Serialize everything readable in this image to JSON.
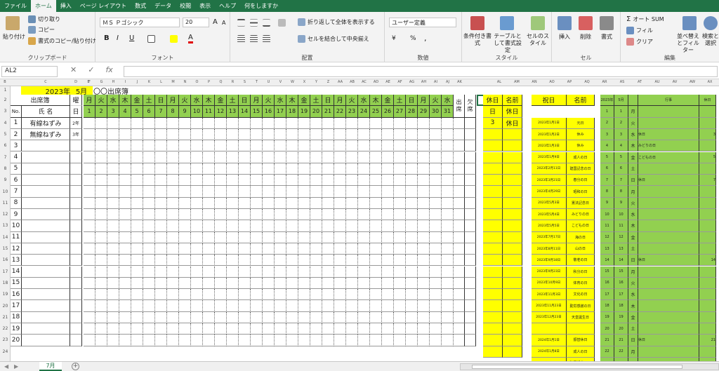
{
  "menu": {
    "tabs": [
      "ファイル",
      "ホーム",
      "挿入",
      "ページ レイアウト",
      "数式",
      "データ",
      "校閲",
      "表示",
      "ヘルプ",
      "何をしますか"
    ],
    "active": 1
  },
  "ribbon": {
    "clipboard": {
      "paste": "貼り付け",
      "cut": "切り取り",
      "copy": "コピー",
      "format_painter": "書式のコピー/貼り付け",
      "label": "クリップボード"
    },
    "font": {
      "name": "ＭＳ Ｐゴシック",
      "size": "20",
      "grow": "A",
      "shrink": "A",
      "bold": "B",
      "italic": "I",
      "underline": "U",
      "label": "フォント"
    },
    "alignment": {
      "wrap": "折り返して全体を表示する",
      "merge": "セルを結合して中央揃え",
      "label": "配置"
    },
    "number": {
      "format": "ユーザー定義",
      "currency": "¥",
      "percent": "%",
      "comma": ",",
      "label": "数値"
    },
    "styles": {
      "conditional": "条件付き書式",
      "table": "テーブルとして書式設定",
      "cell_style": "セルのスタイル",
      "label": "スタイル"
    },
    "cells": {
      "insert": "挿入",
      "delete": "削除",
      "format": "書式",
      "label": "セル"
    },
    "editing": {
      "autosum": "オート SUM",
      "fill": "フィル",
      "clear": "クリア",
      "sort": "並べ替えとフィルター",
      "find": "検索と選択",
      "label": "編集"
    }
  },
  "formula_bar": {
    "name_box": "AL2",
    "value": "",
    "cancel": "✕",
    "enter": "✓",
    "fx": "fx"
  },
  "columns": [
    "B",
    "C",
    "D",
    "E",
    "F",
    "G",
    "H",
    "I",
    "J",
    "K",
    "L",
    "M",
    "N",
    "O",
    "P",
    "Q",
    "R",
    "S",
    "T",
    "U",
    "V",
    "W",
    "X",
    "Y",
    "Z",
    "AA",
    "AB",
    "AC",
    "AD",
    "AE",
    "AF",
    "AG",
    "AH",
    "AI",
    "AJ",
    "AK",
    "AL",
    "AM",
    "AN",
    "AO",
    "AP",
    "AQ",
    "AR",
    "AS",
    "AT",
    "AU",
    "AV",
    "AW",
    "AX"
  ],
  "rows": [
    "1",
    "2",
    "3",
    "4",
    "5",
    "6",
    "7",
    "8",
    "9",
    "10",
    "11",
    "12",
    "13",
    "14",
    "15",
    "16",
    "17",
    "18",
    "19",
    "20",
    "21",
    "22",
    "23",
    "24"
  ],
  "sheet": {
    "year": "2023年",
    "month": "5月",
    "title": "〇〇出席簿",
    "header_title": "出席簿",
    "header_name": "氏 名",
    "header_no": "No.",
    "header_you": "曜",
    "header_bi": "日",
    "weekdays": [
      "月",
      "火",
      "水",
      "木",
      "金",
      "土",
      "日",
      "月",
      "火",
      "水",
      "木",
      "金",
      "土",
      "日",
      "月",
      "火",
      "水",
      "木",
      "金",
      "土",
      "日",
      "月",
      "火",
      "水",
      "木",
      "金",
      "土",
      "日",
      "月",
      "火",
      "水"
    ],
    "days": [
      "1",
      "2",
      "3",
      "4",
      "5",
      "6",
      "7",
      "8",
      "9",
      "10",
      "11",
      "12",
      "13",
      "14",
      "15",
      "16",
      "17",
      "18",
      "19",
      "20",
      "21",
      "22",
      "23",
      "24",
      "25",
      "26",
      "27",
      "28",
      "29",
      "30",
      "31"
    ],
    "attend": "出席",
    "absent": "欠席",
    "row_numbers": [
      "1",
      "2",
      "3",
      "4",
      "5",
      "6",
      "7",
      "8",
      "9",
      "10",
      "11",
      "12",
      "13",
      "14",
      "15",
      "16",
      "17",
      "18",
      "19",
      "20"
    ],
    "students": [
      {
        "name": "有線ねずみ",
        "grade": "2年"
      },
      {
        "name": "無線ねずみ",
        "grade": "3年"
      }
    ]
  },
  "holiday_panel": {
    "header_date": "休日",
    "header_name": "名前",
    "entries": [
      [
        "日",
        "休日"
      ],
      [
        "3",
        "休日"
      ]
    ]
  },
  "holiday_list": {
    "header_date": "祝日",
    "header_name": "名前",
    "entries": [
      [
        "2023年1月1日",
        "元日"
      ],
      [
        "2023年1月2日",
        "休み"
      ],
      [
        "2023年1月3日",
        "休み"
      ],
      [
        "2023年1月9日",
        "成人の日"
      ],
      [
        "2023年2月11日",
        "建国記念の日"
      ],
      [
        "2023年3月21日",
        "春分の日"
      ],
      [
        "2023年4月29日",
        "昭和の日"
      ],
      [
        "2023年5月3日",
        "憲法記念日"
      ],
      [
        "2023年5月4日",
        "みどりの日"
      ],
      [
        "2023年5月5日",
        "こどもの日"
      ],
      [
        "2023年7月17日",
        "海の日"
      ],
      [
        "2023年8月11日",
        "山の日"
      ],
      [
        "2023年9月18日",
        "敬老の日"
      ],
      [
        "2023年9月23日",
        "秋分の日"
      ],
      [
        "2023年10月9日",
        "体育の日"
      ],
      [
        "2023年11月3日",
        "文化の日"
      ],
      [
        "2023年11月23日",
        "勤労感謝の日"
      ],
      [
        "2023年12月23日",
        "天皇誕生日"
      ],
      [
        "",
        ""
      ],
      [
        "2024年1月1日",
        "振替休日"
      ],
      [
        "2024年1月8日",
        "成人の日"
      ],
      [
        "2024年2月11日",
        "建国記念の日"
      ],
      [
        "2024年3月20日",
        "春分の日"
      ]
    ]
  },
  "calendar": {
    "year": "2023年",
    "month": "5月",
    "header_event": "行事",
    "header_holiday": "休日",
    "entries": [
      [
        "1",
        "1",
        "月",
        "",
        ""
      ],
      [
        "2",
        "2",
        "火",
        "",
        ""
      ],
      [
        "3",
        "3",
        "水",
        "休日",
        "3"
      ],
      [
        "4",
        "4",
        "木",
        "みどりの日",
        ""
      ],
      [
        "5",
        "5",
        "金",
        "こどもの日",
        "5"
      ],
      [
        "6",
        "6",
        "土",
        "",
        ""
      ],
      [
        "7",
        "7",
        "日",
        "休日",
        "7"
      ],
      [
        "8",
        "8",
        "月",
        "",
        ""
      ],
      [
        "9",
        "9",
        "火",
        "",
        ""
      ],
      [
        "10",
        "10",
        "水",
        "",
        ""
      ],
      [
        "11",
        "11",
        "木",
        "",
        ""
      ],
      [
        "12",
        "12",
        "金",
        "",
        ""
      ],
      [
        "13",
        "13",
        "土",
        "",
        ""
      ],
      [
        "14",
        "14",
        "日",
        "休日",
        "14"
      ],
      [
        "15",
        "15",
        "月",
        "",
        ""
      ],
      [
        "16",
        "16",
        "火",
        "",
        ""
      ],
      [
        "17",
        "17",
        "水",
        "",
        ""
      ],
      [
        "18",
        "18",
        "木",
        "",
        ""
      ],
      [
        "19",
        "19",
        "金",
        "",
        ""
      ],
      [
        "20",
        "20",
        "土",
        "",
        ""
      ],
      [
        "21",
        "21",
        "日",
        "休日",
        "21"
      ],
      [
        "22",
        "22",
        "月",
        "",
        ""
      ],
      [
        "23",
        "23",
        "火",
        "",
        ""
      ]
    ]
  },
  "tabs": {
    "sheet": "7月",
    "add": "+"
  },
  "colors": {
    "excel_green": "#217346",
    "yellow": "#ffff00",
    "green": "#92d050",
    "grid": "#d4d4d4"
  }
}
